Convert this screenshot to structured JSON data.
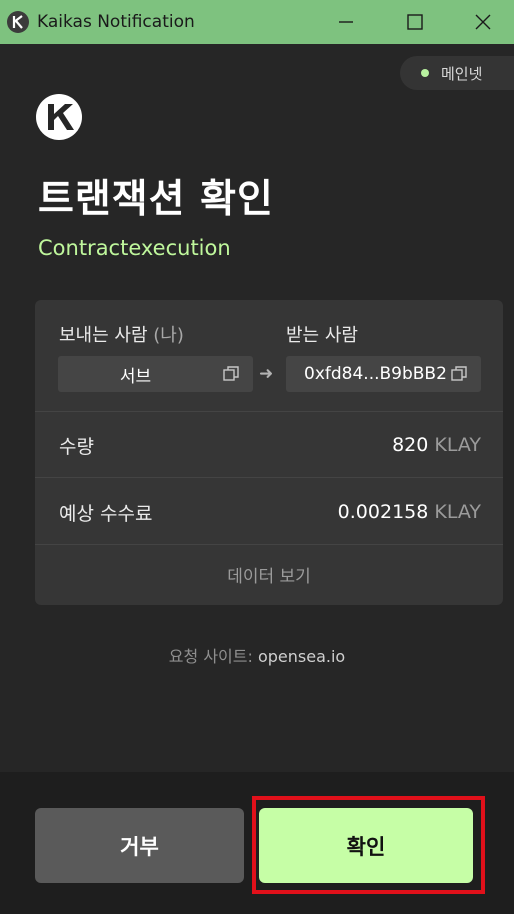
{
  "window": {
    "title": "Kaikas Notification",
    "controls": {
      "minimize": "—",
      "maximize": "☐",
      "close": "✕"
    }
  },
  "network": {
    "label": "메인넷",
    "status_color": "#b9f1a0"
  },
  "header": {
    "title": "트랜잭션 확인",
    "subtitle": "Contractexecution"
  },
  "transfer": {
    "from_label": "보내는 사람",
    "from_suffix": "(나)",
    "to_label": "받는 사람",
    "from_value": "서브",
    "to_value": "0xfd84...B9bBB2"
  },
  "amount": {
    "label": "수량",
    "value": "820",
    "unit": "KLAY"
  },
  "fee": {
    "label": "예상 수수료",
    "value": "0.002158",
    "unit": "KLAY"
  },
  "view_data": "데이터 보기",
  "site": {
    "label": "요청 사이트:",
    "host": "opensea.io"
  },
  "buttons": {
    "reject": "거부",
    "confirm": "확인"
  },
  "colors": {
    "accent": "#c6fea6",
    "titlebar": "#7ec27f",
    "highlight": "#e1101a"
  }
}
